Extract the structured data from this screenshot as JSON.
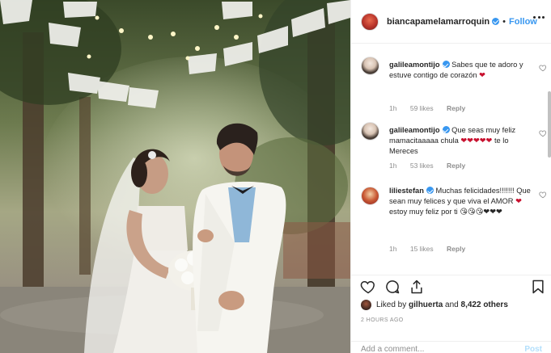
{
  "header": {
    "username": "biancapamelamarroquin",
    "follow_label": "Follow",
    "dot": "•"
  },
  "comments": [
    {
      "username": "galileamontijo",
      "text": "Sabes que te adoro y estuve contigo de corazón",
      "emoji": "❤",
      "time": "1h",
      "likes": "59 likes",
      "reply": "Reply"
    },
    {
      "username": "galileamontijo",
      "text": "Que seas muy feliz mamacitaaaaa chula",
      "emoji_mid": "❤❤❤❤❤",
      "text_end": "te lo Mereces",
      "time": "1h",
      "likes": "53 likes",
      "reply": "Reply"
    },
    {
      "username": "liliestefan",
      "text": "Muchas felicidades!!!!!!! Que sean muy felices y que viva el AMOR",
      "emoji": "❤",
      "text_end": "estoy muy feliz por ti",
      "emoji_end": "😘😘😘❤❤❤",
      "time": "1h",
      "likes": "15 likes",
      "reply": "Reply"
    }
  ],
  "liked_by": {
    "prefix": "Liked by",
    "user": "gilhuerta",
    "joiner": "and",
    "count": "8,422 others"
  },
  "timestamp": "2 HOURS AGO",
  "add_comment": {
    "placeholder": "Add a comment...",
    "post_label": "Post"
  },
  "icons": {
    "like": "heart-icon",
    "comment": "comment-icon",
    "share": "share-icon",
    "save": "bookmark-icon",
    "more": "more-options-icon"
  },
  "colors": {
    "link_blue": "#3897f0",
    "post_disabled": "#b2dffc",
    "muted": "#8e8e8e",
    "heart_red": "#c8102e"
  }
}
